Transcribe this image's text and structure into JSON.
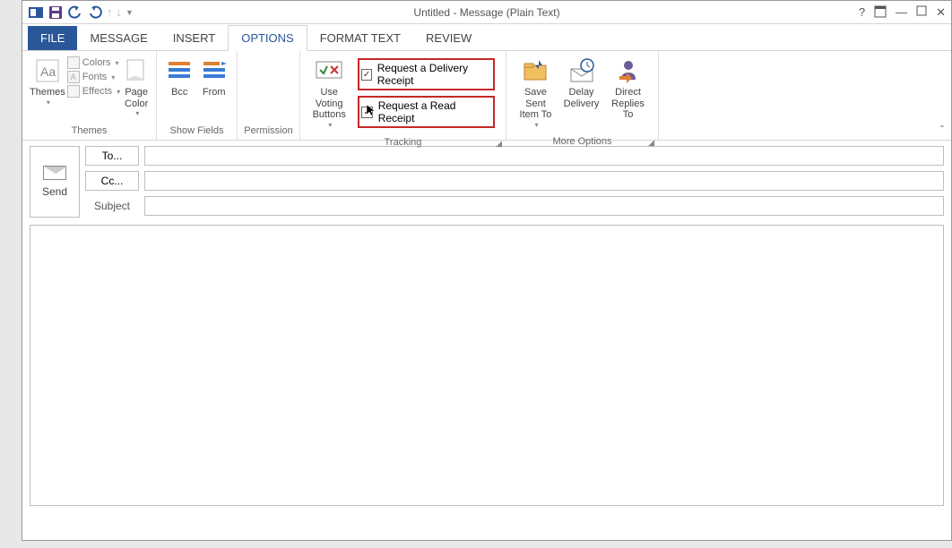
{
  "window": {
    "title": "Untitled - Message (Plain Text)"
  },
  "tabs": {
    "file": "FILE",
    "items": [
      "MESSAGE",
      "INSERT",
      "OPTIONS",
      "FORMAT TEXT",
      "REVIEW"
    ],
    "active_index": 2
  },
  "ribbon": {
    "themes": {
      "label": "Themes",
      "themes_btn": "Themes",
      "colors": "Colors",
      "fonts": "Fonts",
      "effects": "Effects",
      "page_color": "Page\nColor"
    },
    "show_fields": {
      "label": "Show Fields",
      "bcc": "Bcc",
      "from": "From"
    },
    "permission": {
      "label": "Permission"
    },
    "tracking": {
      "label": "Tracking",
      "voting": "Use Voting\nButtons",
      "delivery_receipt": "Request a Delivery Receipt",
      "read_receipt": "Request a Read Receipt"
    },
    "more_options": {
      "label": "More Options",
      "save_sent": "Save Sent\nItem To",
      "delay": "Delay\nDelivery",
      "direct": "Direct\nReplies To"
    }
  },
  "compose": {
    "send": "Send",
    "to": "To...",
    "cc": "Cc...",
    "subject": "Subject",
    "to_value": "",
    "cc_value": "",
    "subject_value": "",
    "body_value": ""
  }
}
